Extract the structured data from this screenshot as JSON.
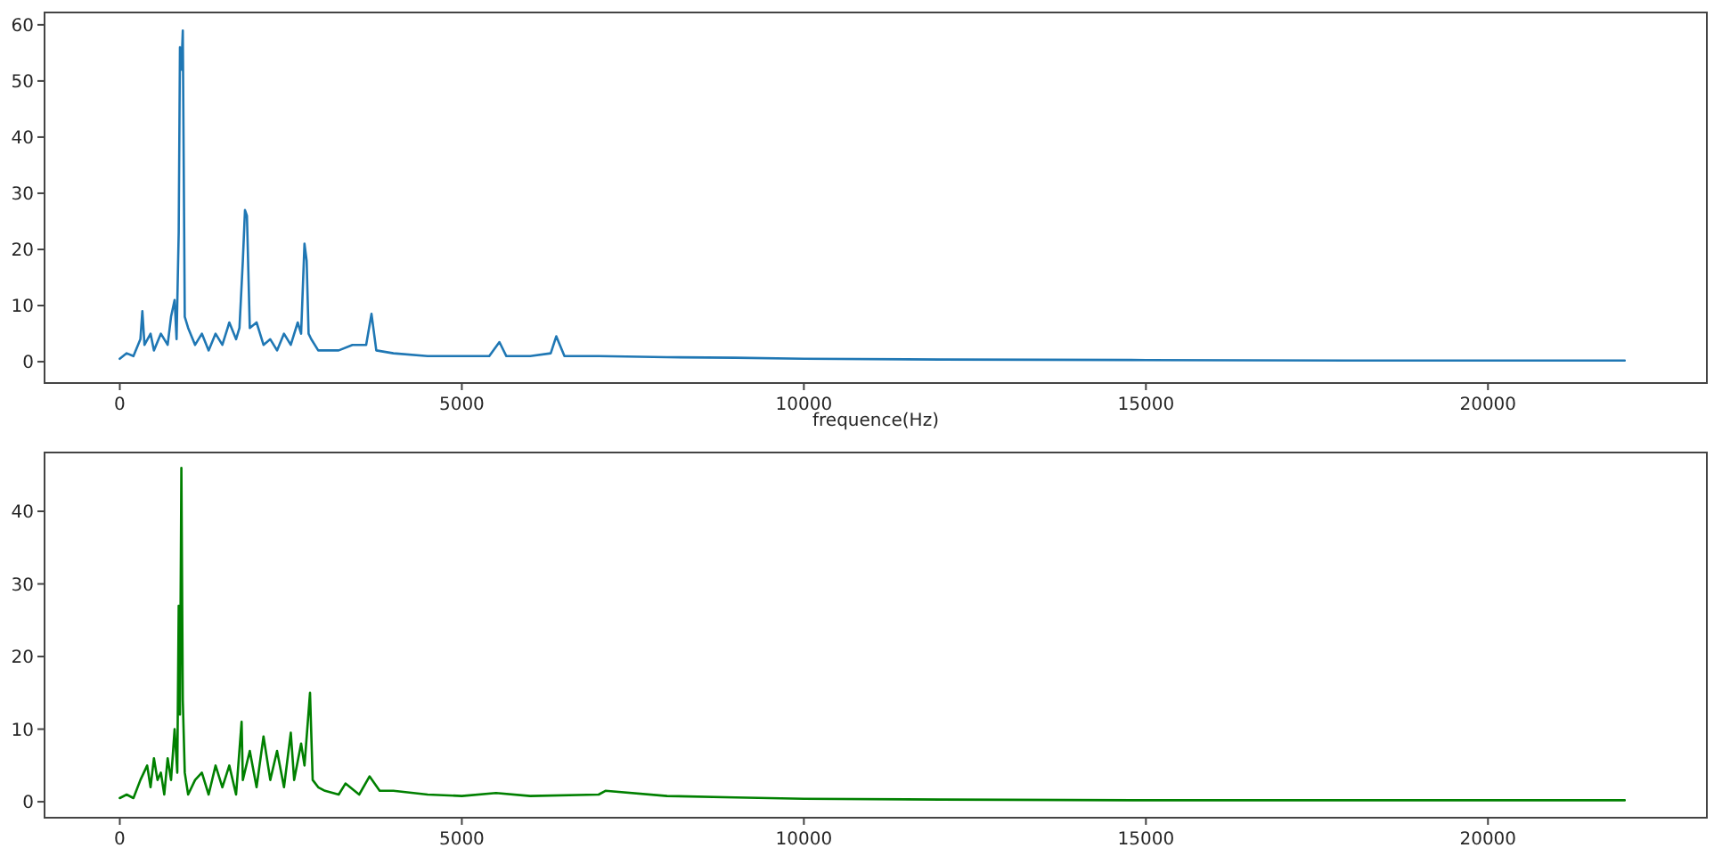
{
  "charts": [
    {
      "chart_data": {
        "type": "line",
        "xlabel": "frequence(Hz)",
        "xlim": [
          -1100,
          23200
        ],
        "ylim": [
          -3.8,
          62.2
        ],
        "xticks": [
          0,
          5000,
          10000,
          15000,
          20000
        ],
        "yticks": [
          0,
          10,
          20,
          30,
          40,
          50,
          60
        ],
        "x": [
          0,
          100,
          200,
          300,
          330,
          360,
          450,
          500,
          600,
          700,
          750,
          800,
          830,
          860,
          880,
          900,
          920,
          950,
          1000,
          1100,
          1200,
          1300,
          1400,
          1500,
          1600,
          1700,
          1750,
          1800,
          1830,
          1860,
          1900,
          2000,
          2100,
          2200,
          2300,
          2400,
          2500,
          2600,
          2650,
          2700,
          2730,
          2760,
          2800,
          2900,
          3000,
          3200,
          3400,
          3600,
          3680,
          3750,
          4000,
          4500,
          5000,
          5400,
          5550,
          5650,
          6000,
          6300,
          6380,
          6500,
          7000,
          8000,
          9000,
          10000,
          12000,
          15000,
          18000,
          22000
        ],
        "series": [
          {
            "color": "#1f77b4",
            "values": [
              0.5,
              1.5,
              1,
              4,
              9,
              3,
              5,
              2,
              5,
              3,
              8,
              11,
              4,
              23,
              56,
              52,
              59,
              8,
              6,
              3,
              5,
              2,
              5,
              3,
              7,
              4,
              6,
              18,
              27,
              26,
              6,
              7,
              3,
              4,
              2,
              5,
              3,
              7,
              5,
              21,
              18,
              5,
              4,
              2,
              2,
              2,
              3,
              3,
              8.5,
              2,
              1.5,
              1,
              1,
              1,
              3.5,
              1,
              1,
              1.5,
              4.5,
              1,
              1,
              0.8,
              0.7,
              0.5,
              0.4,
              0.3,
              0.2,
              0.2
            ]
          }
        ]
      }
    },
    {
      "chart_data": {
        "type": "line",
        "xlim": [
          -1100,
          23200
        ],
        "ylim": [
          -2.2,
          48.1
        ],
        "xticks": [
          0,
          5000,
          10000,
          15000,
          20000
        ],
        "yticks": [
          0,
          10,
          20,
          30,
          40
        ],
        "x": [
          0,
          100,
          200,
          300,
          400,
          450,
          500,
          550,
          600,
          650,
          700,
          750,
          800,
          840,
          860,
          880,
          900,
          920,
          950,
          1000,
          1100,
          1200,
          1300,
          1400,
          1500,
          1600,
          1700,
          1780,
          1800,
          1900,
          2000,
          2100,
          2200,
          2300,
          2400,
          2500,
          2550,
          2650,
          2700,
          2780,
          2820,
          2900,
          3000,
          3200,
          3300,
          3500,
          3650,
          3800,
          4000,
          4500,
          5000,
          5500,
          6000,
          7000,
          7100,
          8000,
          9000,
          10000,
          12000,
          15000,
          18000,
          22000
        ],
        "series": [
          {
            "color": "#008000",
            "values": [
              0.5,
              1,
              0.5,
              3,
              5,
              2,
              6,
              3,
              4,
              1,
              6,
              3,
              10,
              4,
              27,
              12,
              46,
              14,
              4,
              1,
              3,
              4,
              1,
              5,
              2,
              5,
              1,
              11,
              3,
              7,
              2,
              9,
              3,
              7,
              2,
              9.5,
              3,
              8,
              5,
              15,
              3,
              2,
              1.5,
              1,
              2.5,
              1,
              3.5,
              1.5,
              1.5,
              1,
              0.8,
              1.2,
              0.8,
              1,
              1.5,
              0.8,
              0.6,
              0.4,
              0.3,
              0.2,
              0.2,
              0.2
            ]
          }
        ]
      }
    }
  ]
}
